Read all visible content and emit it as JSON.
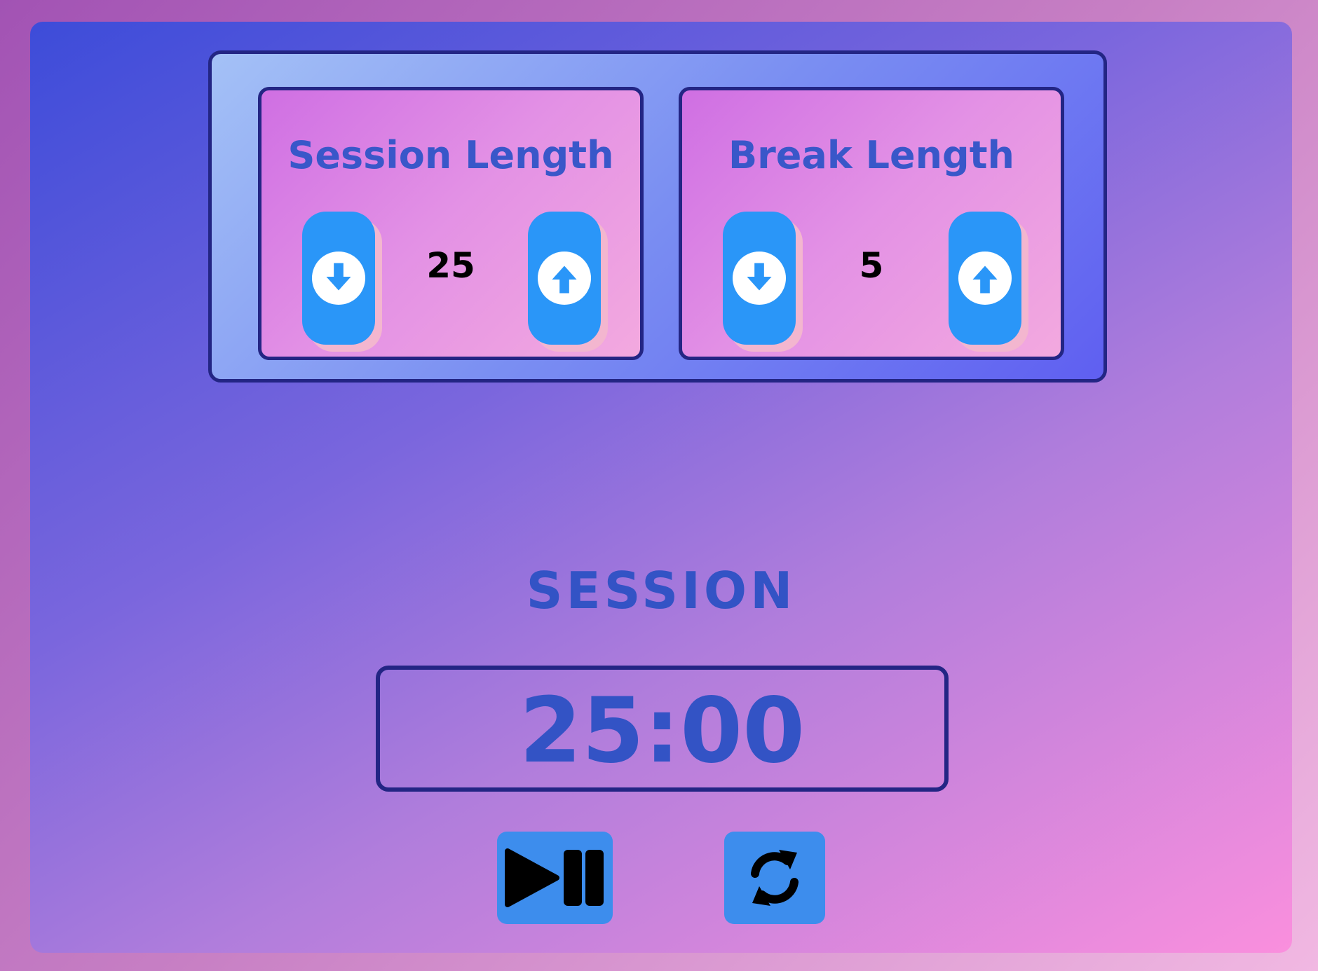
{
  "settings": {
    "session": {
      "title": "Session Length",
      "value": "25",
      "decrement_icon": "arrow-circle-down-icon",
      "increment_icon": "arrow-circle-up-icon"
    },
    "break": {
      "title": "Break Length",
      "value": "5",
      "decrement_icon": "arrow-circle-down-icon",
      "increment_icon": "arrow-circle-up-icon"
    }
  },
  "timer": {
    "label": "SESSION",
    "value": "25:00"
  },
  "controls": {
    "play_pause_icon": "play-pause-icon",
    "reset_icon": "sync-icon"
  },
  "colors": {
    "accent_text": "#3353c5",
    "button": "#2a96f8",
    "control_button": "#3d8ded",
    "border": "#232584"
  }
}
